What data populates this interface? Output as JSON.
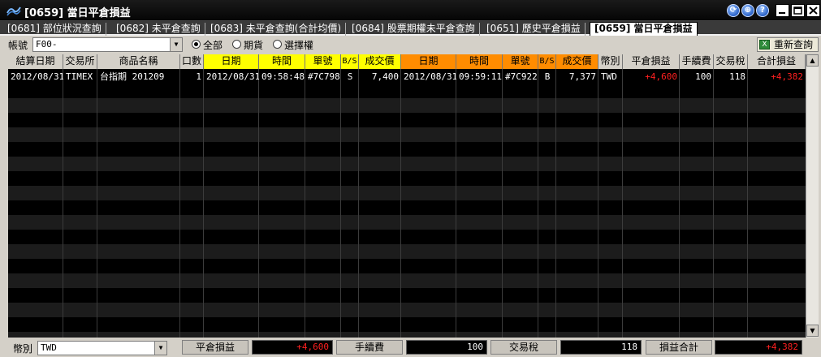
{
  "window": {
    "title": "[0659] 當日平倉損益",
    "buttons": {
      "help_1": "⟳",
      "help_2": "⊕",
      "help_3": "?"
    }
  },
  "tabs": [
    {
      "label": "[0681] 部位狀況查詢",
      "active": false
    },
    {
      "label": "[0682] 未平倉查詢",
      "active": false
    },
    {
      "label": "[0683] 未平倉查詢(合計均價)",
      "active": false
    },
    {
      "label": "[0684] 股票期權未平倉查詢",
      "active": false
    },
    {
      "label": "[0651] 歷史平倉損益",
      "active": false
    },
    {
      "label": "[0659] 當日平倉損益",
      "active": true
    }
  ],
  "filter": {
    "account_label": "帳號",
    "account_value": "F00-",
    "radio_all": "全部",
    "radio_futures": "期貨",
    "radio_options": "選擇權",
    "selected": "全部",
    "refresh_label": "重新查詢"
  },
  "table": {
    "headers": [
      "結算日期",
      "交易所",
      "商品名稱",
      "口數",
      "日期",
      "時間",
      "單號",
      "B/S",
      "成交價",
      "日期",
      "時間",
      "單號",
      "B/S",
      "成交價",
      "幣別",
      "平倉損益",
      "手續費",
      "交易稅",
      "合計損益"
    ],
    "rows": [
      [
        "2012/08/31",
        "TIMEX",
        "台指期 201209",
        "1",
        "2012/08/31",
        "09:58:48",
        "#7C798",
        "S",
        "7,400",
        "2012/08/31",
        "09:59:11",
        "#7C922",
        "B",
        "7,377",
        "TWD",
        "+4,600",
        "100",
        "118",
        "+4,382"
      ]
    ]
  },
  "footer": {
    "currency_label": "幣別",
    "currency_value": "TWD",
    "pl_label": "平倉損益",
    "pl_value": "+4,600",
    "fee_label": "手續費",
    "fee_value": "100",
    "tax_label": "交易稅",
    "tax_value": "118",
    "total_label": "損益合計",
    "total_value": "+4,382"
  },
  "colors": {
    "profit": "#ff2020",
    "open_header": "#ffff00",
    "close_header": "#ff8c00"
  }
}
